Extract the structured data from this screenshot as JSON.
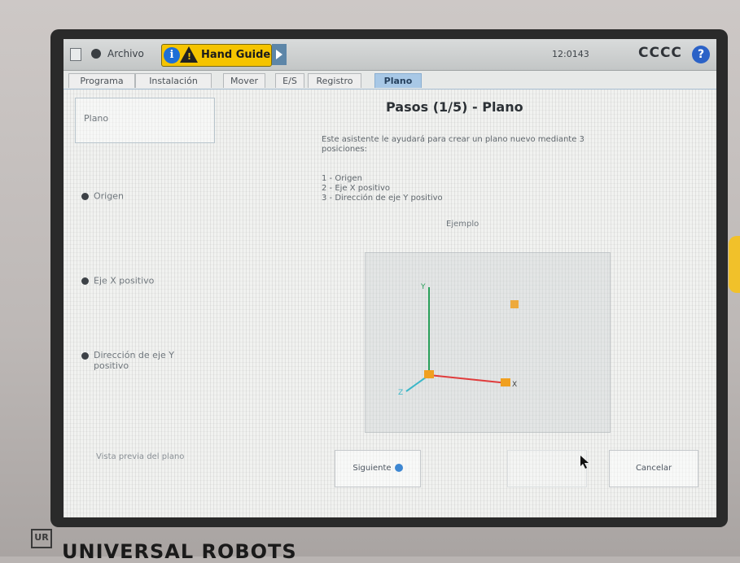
{
  "titlebar": {
    "menu_label": "Archivo",
    "hand_guide_label": "Hand Guide",
    "time": "12:0143",
    "user": "CCCC",
    "help_glyph": "?"
  },
  "tabs": [
    {
      "label": "Programa"
    },
    {
      "label": "Instalación"
    },
    {
      "label": "Mover"
    },
    {
      "label": "E/S"
    },
    {
      "label": "Registro"
    },
    {
      "label": "Plano"
    }
  ],
  "left_panel": {
    "plano_label": "Plano",
    "steps": [
      {
        "label": "Origen"
      },
      {
        "label": "Eje X positivo"
      },
      {
        "label": "Dirección de eje Y positivo"
      }
    ],
    "bottom_note": "Vista previa del plano"
  },
  "main": {
    "title": "Pasos (1/5) - Plano",
    "description": "Este asistente le ayudará para crear un plano nuevo mediante 3 posiciones:",
    "steps_list": [
      "1 - Origen",
      "2 - Eje X positivo",
      "3 - Dirección de eje Y positivo"
    ],
    "example_label": "Ejemplo",
    "axis_labels": {
      "x": "X",
      "y": "Y",
      "z": "Z"
    }
  },
  "buttons": {
    "next_label": "Siguiente",
    "cancel_label": "Cancelar"
  },
  "brand": {
    "logo_text": "UR",
    "name": "UNIVERSAL ROBOTS"
  },
  "colors": {
    "axis_x": "#e03c3c",
    "axis_y": "#2a9f5a",
    "axis_z": "#3cb7c8",
    "point": "#f0a020",
    "hand_guide_bg": "#f5c400",
    "active_tab": "#a8c8e6"
  }
}
